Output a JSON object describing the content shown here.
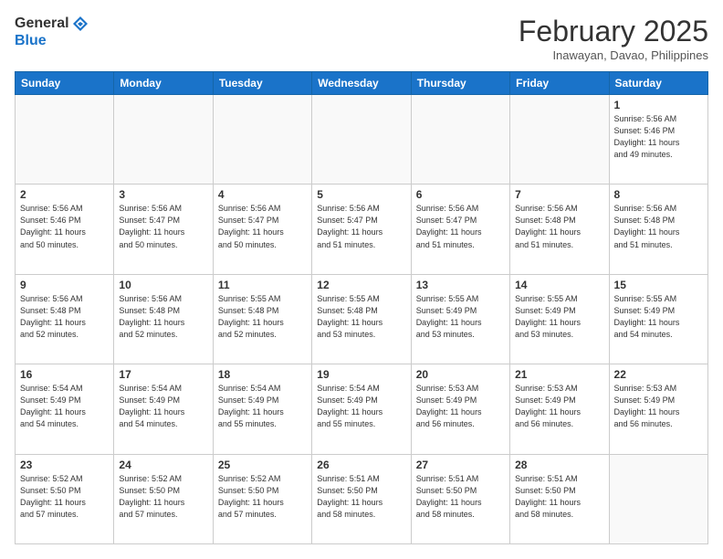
{
  "header": {
    "logo_general": "General",
    "logo_blue": "Blue",
    "month_title": "February 2025",
    "location": "Inawayan, Davao, Philippines"
  },
  "weekdays": [
    "Sunday",
    "Monday",
    "Tuesday",
    "Wednesday",
    "Thursday",
    "Friday",
    "Saturday"
  ],
  "weeks": [
    [
      {
        "day": "",
        "info": ""
      },
      {
        "day": "",
        "info": ""
      },
      {
        "day": "",
        "info": ""
      },
      {
        "day": "",
        "info": ""
      },
      {
        "day": "",
        "info": ""
      },
      {
        "day": "",
        "info": ""
      },
      {
        "day": "1",
        "info": "Sunrise: 5:56 AM\nSunset: 5:46 PM\nDaylight: 11 hours\nand 49 minutes."
      }
    ],
    [
      {
        "day": "2",
        "info": "Sunrise: 5:56 AM\nSunset: 5:46 PM\nDaylight: 11 hours\nand 50 minutes."
      },
      {
        "day": "3",
        "info": "Sunrise: 5:56 AM\nSunset: 5:47 PM\nDaylight: 11 hours\nand 50 minutes."
      },
      {
        "day": "4",
        "info": "Sunrise: 5:56 AM\nSunset: 5:47 PM\nDaylight: 11 hours\nand 50 minutes."
      },
      {
        "day": "5",
        "info": "Sunrise: 5:56 AM\nSunset: 5:47 PM\nDaylight: 11 hours\nand 51 minutes."
      },
      {
        "day": "6",
        "info": "Sunrise: 5:56 AM\nSunset: 5:47 PM\nDaylight: 11 hours\nand 51 minutes."
      },
      {
        "day": "7",
        "info": "Sunrise: 5:56 AM\nSunset: 5:48 PM\nDaylight: 11 hours\nand 51 minutes."
      },
      {
        "day": "8",
        "info": "Sunrise: 5:56 AM\nSunset: 5:48 PM\nDaylight: 11 hours\nand 51 minutes."
      }
    ],
    [
      {
        "day": "9",
        "info": "Sunrise: 5:56 AM\nSunset: 5:48 PM\nDaylight: 11 hours\nand 52 minutes."
      },
      {
        "day": "10",
        "info": "Sunrise: 5:56 AM\nSunset: 5:48 PM\nDaylight: 11 hours\nand 52 minutes."
      },
      {
        "day": "11",
        "info": "Sunrise: 5:55 AM\nSunset: 5:48 PM\nDaylight: 11 hours\nand 52 minutes."
      },
      {
        "day": "12",
        "info": "Sunrise: 5:55 AM\nSunset: 5:48 PM\nDaylight: 11 hours\nand 53 minutes."
      },
      {
        "day": "13",
        "info": "Sunrise: 5:55 AM\nSunset: 5:49 PM\nDaylight: 11 hours\nand 53 minutes."
      },
      {
        "day": "14",
        "info": "Sunrise: 5:55 AM\nSunset: 5:49 PM\nDaylight: 11 hours\nand 53 minutes."
      },
      {
        "day": "15",
        "info": "Sunrise: 5:55 AM\nSunset: 5:49 PM\nDaylight: 11 hours\nand 54 minutes."
      }
    ],
    [
      {
        "day": "16",
        "info": "Sunrise: 5:54 AM\nSunset: 5:49 PM\nDaylight: 11 hours\nand 54 minutes."
      },
      {
        "day": "17",
        "info": "Sunrise: 5:54 AM\nSunset: 5:49 PM\nDaylight: 11 hours\nand 54 minutes."
      },
      {
        "day": "18",
        "info": "Sunrise: 5:54 AM\nSunset: 5:49 PM\nDaylight: 11 hours\nand 55 minutes."
      },
      {
        "day": "19",
        "info": "Sunrise: 5:54 AM\nSunset: 5:49 PM\nDaylight: 11 hours\nand 55 minutes."
      },
      {
        "day": "20",
        "info": "Sunrise: 5:53 AM\nSunset: 5:49 PM\nDaylight: 11 hours\nand 56 minutes."
      },
      {
        "day": "21",
        "info": "Sunrise: 5:53 AM\nSunset: 5:49 PM\nDaylight: 11 hours\nand 56 minutes."
      },
      {
        "day": "22",
        "info": "Sunrise: 5:53 AM\nSunset: 5:49 PM\nDaylight: 11 hours\nand 56 minutes."
      }
    ],
    [
      {
        "day": "23",
        "info": "Sunrise: 5:52 AM\nSunset: 5:50 PM\nDaylight: 11 hours\nand 57 minutes."
      },
      {
        "day": "24",
        "info": "Sunrise: 5:52 AM\nSunset: 5:50 PM\nDaylight: 11 hours\nand 57 minutes."
      },
      {
        "day": "25",
        "info": "Sunrise: 5:52 AM\nSunset: 5:50 PM\nDaylight: 11 hours\nand 57 minutes."
      },
      {
        "day": "26",
        "info": "Sunrise: 5:51 AM\nSunset: 5:50 PM\nDaylight: 11 hours\nand 58 minutes."
      },
      {
        "day": "27",
        "info": "Sunrise: 5:51 AM\nSunset: 5:50 PM\nDaylight: 11 hours\nand 58 minutes."
      },
      {
        "day": "28",
        "info": "Sunrise: 5:51 AM\nSunset: 5:50 PM\nDaylight: 11 hours\nand 58 minutes."
      },
      {
        "day": "",
        "info": ""
      }
    ]
  ]
}
